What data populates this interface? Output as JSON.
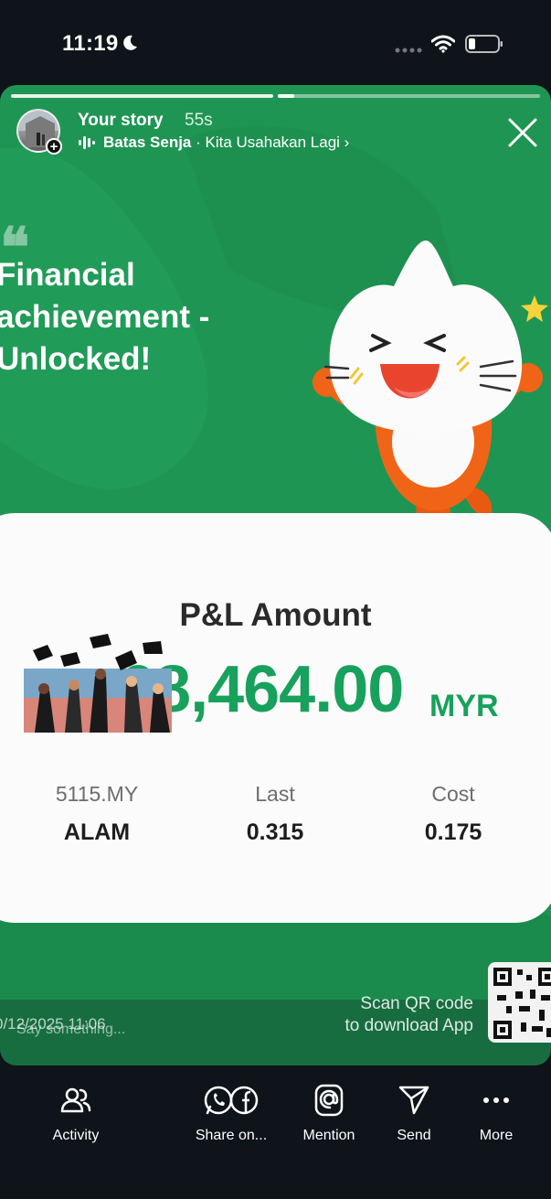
{
  "status_bar": {
    "time": "11:19"
  },
  "story": {
    "title": "Your story",
    "time_ago": "55s",
    "music": {
      "artist": "Batas Senja",
      "separator": " · ",
      "song": "Kita Usahakan Lagi",
      "chevron": "›"
    }
  },
  "post": {
    "quote_mark": "❝",
    "headline": [
      "Financial",
      "achievement -",
      "Unlocked!"
    ],
    "pl_label": "P&L Amount",
    "pl_amount": "68,464.00",
    "pl_currency": "MYR",
    "stats": [
      {
        "label": "5115.MY",
        "value": "ALAM"
      },
      {
        "label": "Last",
        "value": "0.315"
      },
      {
        "label": "Cost",
        "value": "0.175"
      }
    ],
    "scan_text": [
      "Scan QR code",
      "to download App"
    ],
    "date_text": "0/12/2025 11:06",
    "reply_placeholder": "Say something..."
  },
  "bottom_nav": [
    {
      "label": "Activity",
      "icon": "people-icon"
    },
    {
      "label": "Share on...",
      "icon": "whatsapp-facebook-icon"
    },
    {
      "label": "Mention",
      "icon": "at-icon"
    },
    {
      "label": "Send",
      "icon": "paper-plane-icon"
    },
    {
      "label": "More",
      "icon": "more-dots-icon"
    }
  ],
  "colors": {
    "story_green": "#1f9553",
    "amount_green": "#18a15c",
    "cat_orange": "#f06418",
    "background": "#0f141a"
  }
}
